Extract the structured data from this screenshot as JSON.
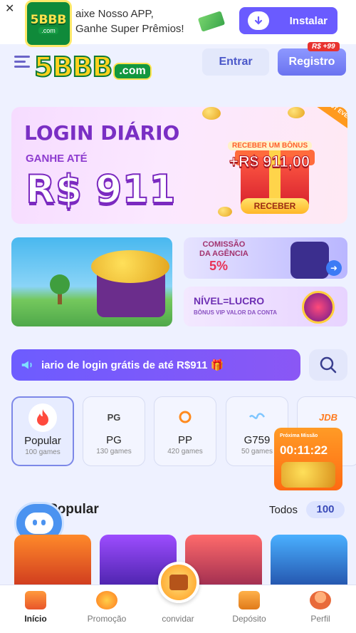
{
  "download_bar": {
    "close": "✕",
    "logo_text": "5BBB",
    "logo_sub": ".com",
    "line1": "aixe Nosso APP,",
    "line2": "Ganhe Super Prêmios!",
    "install_label": "Instalar"
  },
  "header": {
    "logo_text": "5BBB",
    "logo_sub": ".com",
    "login_label": "Entrar",
    "register_label": "Registro",
    "register_badge": "R$ +99"
  },
  "hero": {
    "title": "LOGIN DIÁRIO",
    "subtitle": "GANHE ATÉ",
    "amount": "R$ 911",
    "gift_caption": "RECEBER UM BÔNUS",
    "gift_amount": "+R$ 911,00",
    "gift_button": "RECEBER",
    "corner_badge": "NOT EVENT"
  },
  "banners": {
    "agency_line1": "COMISSÃO",
    "agency_line2": "DA AGÊNCIA",
    "agency_pct": "5%",
    "level_title": "NÍVEL=LUCRO",
    "level_sub": "BÔNUS VIP VALOR DA CONTA"
  },
  "marquee": {
    "text": "iario de login grátis de até R$911 🎁"
  },
  "categories": [
    {
      "name": "Popular",
      "count": "100 games",
      "icon": "fire-icon"
    },
    {
      "name": "PG",
      "count": "130 games",
      "icon": "pg-icon"
    },
    {
      "name": "PP",
      "count": "420 games",
      "icon": "pp-icon"
    },
    {
      "name": "G759",
      "count": "50 games",
      "icon": "g759-icon"
    },
    {
      "name": "JDB",
      "count": "",
      "icon": "jdb-icon"
    }
  ],
  "category_icon_text": {
    "pg": "PG",
    "jdb": "JDB"
  },
  "timer": {
    "label": "Próxima Missão",
    "time": "00:11:22"
  },
  "section": {
    "title": "Popular",
    "all_label": "Todos",
    "count": "100"
  },
  "nav": [
    {
      "label": "Início",
      "active": true
    },
    {
      "label": "Promoção",
      "active": false
    },
    {
      "label": "convidar",
      "active": false
    },
    {
      "label": "Depósito",
      "active": false
    },
    {
      "label": "Perfil",
      "active": false
    }
  ],
  "colors": {
    "accent": "#6a5bff",
    "brand_green": "#0f8a3a",
    "brand_yellow": "#ffd21f"
  }
}
